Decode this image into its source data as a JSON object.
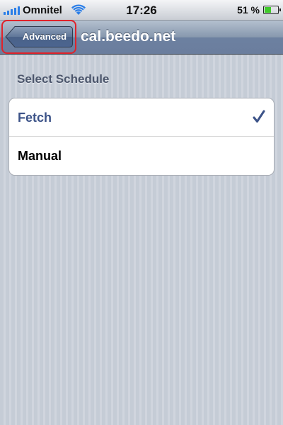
{
  "status_bar": {
    "carrier": "Omnitel",
    "time": "17:26",
    "battery_percent": "51 %",
    "battery_level": 0.51,
    "signal_icon": "signal-bars-icon",
    "wifi_icon": "wifi-icon",
    "battery_icon": "battery-icon"
  },
  "nav_bar": {
    "back_label": "Advanced",
    "title": "cal.beedo.net"
  },
  "section": {
    "header": "Select Schedule",
    "options": [
      {
        "label": "Fetch",
        "selected": true
      },
      {
        "label": "Manual",
        "selected": false
      }
    ],
    "checkmark_icon": "checkmark-icon"
  },
  "colors": {
    "highlight_box": "#e1222a",
    "selected_text": "#3c5388",
    "nav_bar": "#6c80a0",
    "battery_fill": "#3fcb2a",
    "signal": "#2a7ee8"
  }
}
